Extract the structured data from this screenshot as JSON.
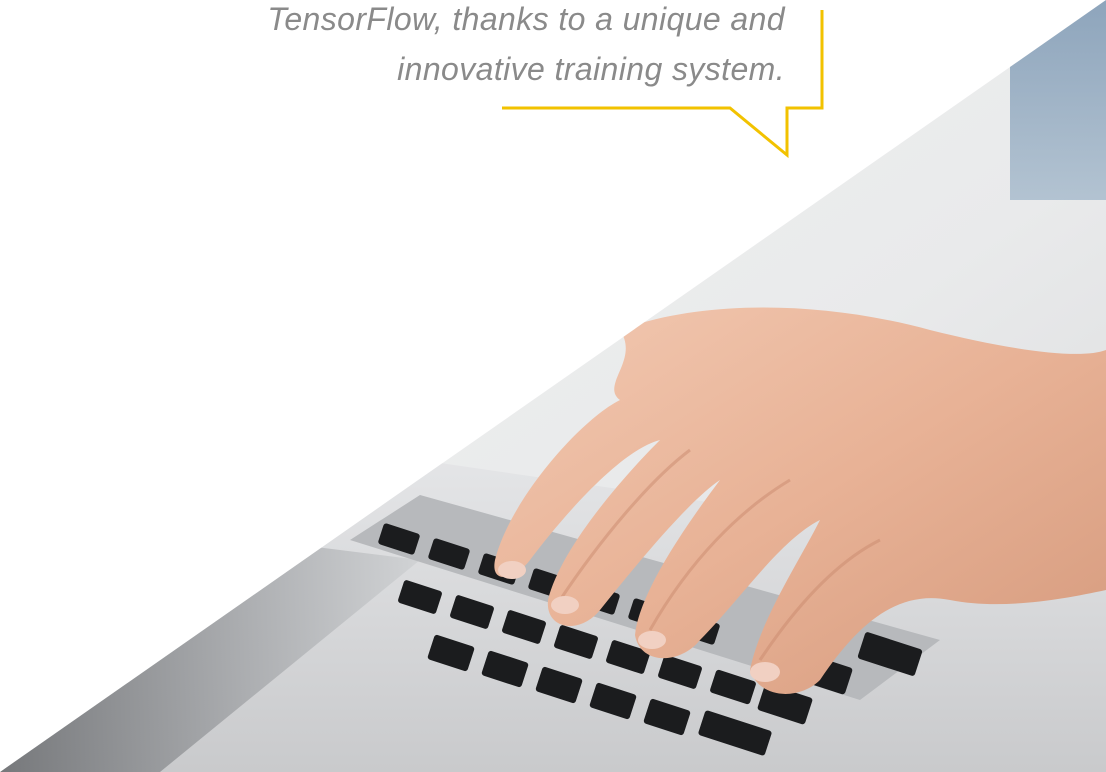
{
  "quote": {
    "line1": "TensorFlow, thanks to a unique and",
    "line2": "innovative training system."
  },
  "photo": {
    "subject": "hand typing on laptop keyboard"
  },
  "colors": {
    "accent": "#f2c200",
    "text": "#8a8a8a",
    "background": "#ffffff"
  }
}
